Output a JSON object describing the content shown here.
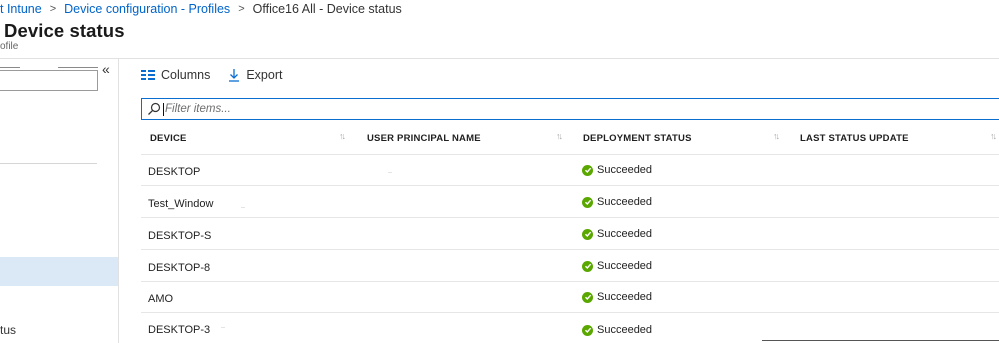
{
  "breadcrumb": {
    "items": [
      "t Intune",
      "Device configuration - Profiles"
    ],
    "current": "Office16 All - Device status"
  },
  "header": {
    "title": "Device status",
    "subtitle": "ofile"
  },
  "left_panel": {
    "partial_item": "tus"
  },
  "toolbar": {
    "columns_label": "Columns",
    "export_label": "Export"
  },
  "filter": {
    "placeholder": "Filter items..."
  },
  "table": {
    "columns": [
      "DEVICE",
      "USER PRINCIPAL NAME",
      "DEPLOYMENT STATUS",
      "LAST STATUS UPDATE"
    ],
    "rows": [
      {
        "device": "DESKTOP",
        "status": "Succeeded"
      },
      {
        "device": "Test_Window",
        "status": "Succeeded"
      },
      {
        "device": "DESKTOP-S",
        "status": "Succeeded"
      },
      {
        "device": "DESKTOP-8",
        "status": "Succeeded"
      },
      {
        "device": "AMO",
        "status": "Succeeded"
      },
      {
        "device": "DESKTOP-3",
        "status": "Succeeded"
      }
    ]
  },
  "colors": {
    "link": "#0064c8",
    "accent": "#0a6ed1",
    "success": "#5aa700",
    "selected_bg": "#dbe8f5"
  },
  "icons": {
    "breadcrumb_separator": "chevron-right-icon",
    "collapse": "double-chevron-left-icon",
    "columns": "columns-icon",
    "export": "download-icon",
    "filter": "search-icon",
    "sort": "sort-arrows-icon",
    "status": "check-circle-icon"
  }
}
